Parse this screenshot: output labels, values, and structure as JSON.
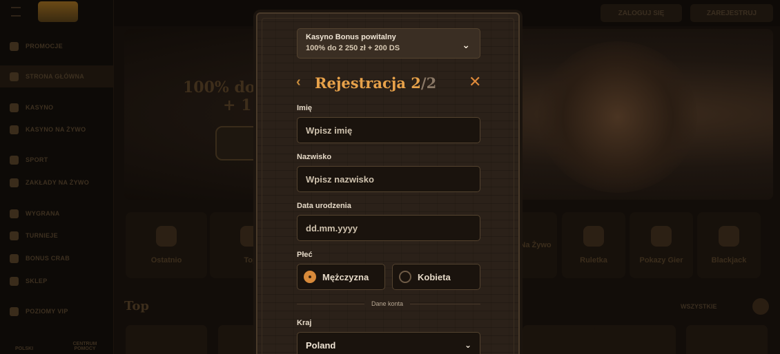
{
  "background": {
    "sidebar": {
      "items": [
        {
          "label": "PROMOCJE"
        },
        {
          "label": "STRONA GŁÓWNA"
        },
        {
          "label": "KASYNO"
        },
        {
          "label": "KASYNO NA ŻYWO"
        },
        {
          "label": "SPORT"
        },
        {
          "label": "ZAKŁADY NA ŻYWO"
        },
        {
          "label": "WYGRANA"
        },
        {
          "label": "TURNIEJE"
        },
        {
          "label": "BONUS CRAB"
        },
        {
          "label": "SKLEP"
        },
        {
          "label": "POZIOMY VIP"
        }
      ],
      "bottom_left": "POLSKI",
      "bottom_right": "CENTRUM POMOCY"
    },
    "topbar": {
      "login": "ZALOGUJ SIĘ",
      "register": "ZAREJESTRUJ"
    },
    "hero": {
      "line1": "100% do 2",
      "line2": "+ 1 B",
      "button": "DOŁ"
    },
    "categories": [
      "Ostatnio",
      "Top",
      "Na Żywo",
      "Ruletka",
      "Pokazy Gier",
      "Blackjack"
    ],
    "section_title": "Top",
    "see_all": "WSZYSTKIE"
  },
  "modal": {
    "bonus": {
      "title": "Kasyno Bonus powitalny",
      "value": "100% do 2 250 zł + 200 DS"
    },
    "title": "Rejestracja",
    "step": "2",
    "total": "/2",
    "fields": {
      "first_name": {
        "label": "Imię",
        "placeholder": "Wpisz imię"
      },
      "last_name": {
        "label": "Nazwisko",
        "placeholder": "Wpisz nazwisko"
      },
      "birthdate": {
        "label": "Data urodzenia",
        "placeholder": "dd.mm.yyyy"
      }
    },
    "gender": {
      "label": "Płeć",
      "options": [
        {
          "label": "Mężczyzna",
          "checked": true
        },
        {
          "label": "Kobieta",
          "checked": false
        }
      ]
    },
    "divider": "Dane konta",
    "country": {
      "label": "Kraj",
      "value": "Poland"
    }
  },
  "colors": {
    "accent": "#e8a24a",
    "modal_bg": "#2b2119",
    "input_bg": "#1a130d"
  }
}
